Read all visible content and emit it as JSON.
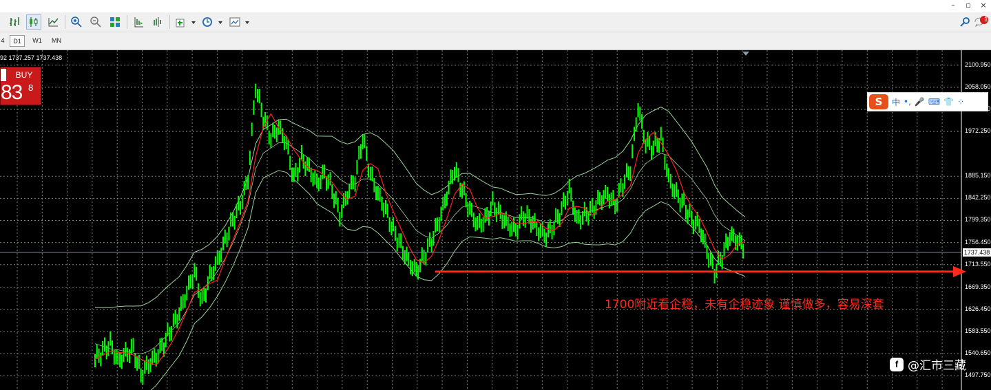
{
  "window": {
    "controls": [
      "–",
      "▫",
      "×"
    ]
  },
  "toolbar": {
    "icons": [
      "bar-chart-icon",
      "candlestick-icon",
      "line-chart-icon",
      "zoom-in-icon",
      "zoom-out-icon",
      "tile-windows-icon",
      "autoscroll-icon",
      "chart-shift-icon",
      "indicators-icon",
      "periods-icon",
      "templates-icon"
    ],
    "right_icons": [
      "search-icon",
      "notifications-icon"
    ],
    "notification_count": "1"
  },
  "timeframes": [
    "4",
    "D1",
    "W1",
    "MN"
  ],
  "active_timeframe": "D1",
  "chart": {
    "info_line": "92 1737.257 1737.438",
    "buy_label": "BUY",
    "buy_big": "83",
    "buy_sup": "8",
    "current_price": "1737.438",
    "price_labels": [
      "2100.950",
      "2058.050",
      "2015.150",
      "1972.250",
      "1885.150",
      "1842.250",
      "1799.350",
      "1756.450",
      "1713.550",
      "1669.350",
      "1626.450",
      "1583.550",
      "1540.650",
      "1497.750"
    ],
    "annotation": "1700附近看企稳，未有企稳迹象 谨慎做多，容易深套",
    "watermark": "@汇市三藏",
    "colors": {
      "price": "#00ff00",
      "ma": "#ff2020",
      "bands": "#9ad29a",
      "arrow": "#ff2a1a",
      "grid": "#7a8a7a"
    }
  },
  "ime_bar": {
    "logo": "S",
    "items": [
      "中",
      "•,",
      "🎤",
      "⌨",
      "👕",
      "⁘"
    ]
  },
  "chart_data": {
    "type": "line",
    "ylim": [
      1470,
      2130
    ],
    "y_ticks": [
      2100.95,
      2058.05,
      2015.15,
      1972.25,
      1885.15,
      1842.25,
      1799.35,
      1756.45,
      1713.55,
      1669.35,
      1626.45,
      1583.55,
      1540.65,
      1497.75
    ],
    "series": [
      {
        "values": [
          1530,
          1545,
          1560,
          1525,
          1540,
          1550,
          1500,
          1520,
          1535,
          1560,
          1590,
          1620,
          1660,
          1700,
          1640,
          1690,
          1720,
          1760,
          1800,
          1830,
          1880,
          2060,
          2000,
          1960,
          1980,
          1950,
          1880,
          1920,
          1900,
          1870,
          1890,
          1860,
          1810,
          1850,
          1880,
          1960,
          1890,
          1850,
          1820,
          1780,
          1750,
          1720,
          1700,
          1730,
          1760,
          1800,
          1850,
          1900,
          1860,
          1820,
          1790,
          1800,
          1830,
          1810,
          1790,
          1780,
          1810,
          1800,
          1780,
          1770,
          1790,
          1820,
          1860,
          1800,
          1810,
          1820,
          1840,
          1850,
          1830,
          1870,
          1900,
          2020,
          1950,
          1940,
          1960,
          1880,
          1850,
          1830,
          1800,
          1790,
          1740,
          1700,
          1730,
          1770,
          1760,
          1745
        ]
      },
      {
        "values": [
          1560,
          1555,
          1550,
          1548,
          1545,
          1542,
          1540,
          1545,
          1555,
          1570,
          1585,
          1600,
          1625,
          1655,
          1665,
          1680,
          1700,
          1725,
          1755,
          1790,
          1830,
          1900,
          1930,
          1940,
          1950,
          1950,
          1940,
          1930,
          1920,
          1905,
          1900,
          1895,
          1880,
          1870,
          1870,
          1880,
          1880,
          1870,
          1855,
          1840,
          1820,
          1800,
          1780,
          1770,
          1765,
          1775,
          1790,
          1810,
          1825,
          1830,
          1825,
          1820,
          1815,
          1815,
          1810,
          1805,
          1805,
          1805,
          1800,
          1795,
          1795,
          1800,
          1810,
          1815,
          1815,
          1818,
          1822,
          1828,
          1830,
          1840,
          1860,
          1890,
          1910,
          1920,
          1930,
          1925,
          1910,
          1895,
          1880,
          1860,
          1840,
          1810,
          1790,
          1780,
          1770,
          1760
        ]
      }
    ],
    "support_level": 1700
  }
}
